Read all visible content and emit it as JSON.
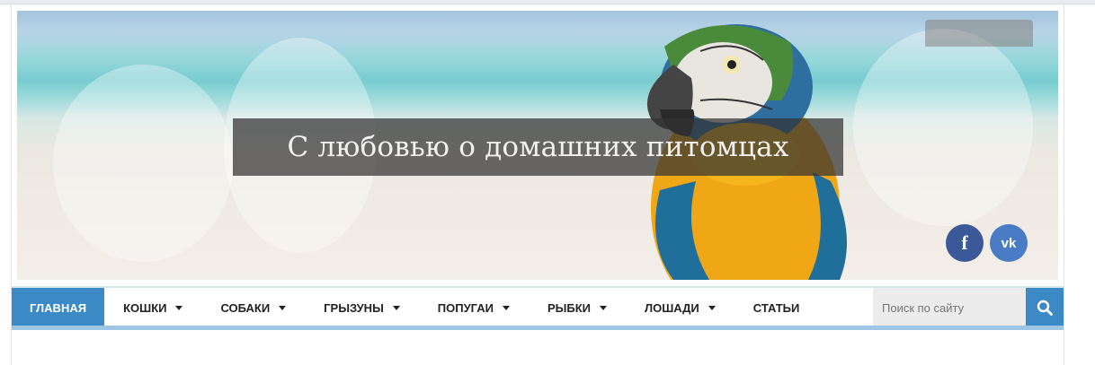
{
  "header": {
    "site_title": "С любовью о домашних питомцах",
    "social": [
      {
        "label": "f",
        "icon": "facebook-icon",
        "color": "#3b5998"
      },
      {
        "label": "vk",
        "icon": "vk-icon",
        "color": "#4a7cc5"
      }
    ]
  },
  "nav": {
    "accent_color": "#3c8ac5",
    "items": [
      {
        "label": "ГЛАВНАЯ",
        "active": true,
        "has_dropdown": false
      },
      {
        "label": "КОШКИ",
        "active": false,
        "has_dropdown": true
      },
      {
        "label": "СОБАКИ",
        "active": false,
        "has_dropdown": true
      },
      {
        "label": "ГРЫЗУНЫ",
        "active": false,
        "has_dropdown": true
      },
      {
        "label": "ПОПУГАИ",
        "active": false,
        "has_dropdown": true
      },
      {
        "label": "РЫБКИ",
        "active": false,
        "has_dropdown": true
      },
      {
        "label": "ЛОШАДИ",
        "active": false,
        "has_dropdown": true
      },
      {
        "label": "СТАТЬИ",
        "active": false,
        "has_dropdown": false
      }
    ]
  },
  "search": {
    "placeholder": "Поиск по сайту",
    "icon": "search-icon"
  }
}
